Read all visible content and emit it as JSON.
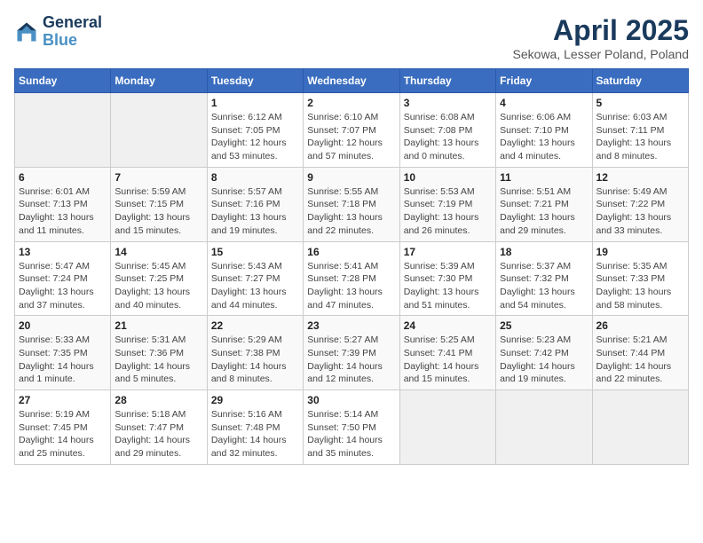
{
  "header": {
    "logo_line1": "General",
    "logo_line2": "Blue",
    "title": "April 2025",
    "subtitle": "Sekowa, Lesser Poland, Poland"
  },
  "weekdays": [
    "Sunday",
    "Monday",
    "Tuesday",
    "Wednesday",
    "Thursday",
    "Friday",
    "Saturday"
  ],
  "weeks": [
    [
      {
        "day": null
      },
      {
        "day": null
      },
      {
        "day": "1",
        "sunrise": "Sunrise: 6:12 AM",
        "sunset": "Sunset: 7:05 PM",
        "daylight": "Daylight: 12 hours and 53 minutes."
      },
      {
        "day": "2",
        "sunrise": "Sunrise: 6:10 AM",
        "sunset": "Sunset: 7:07 PM",
        "daylight": "Daylight: 12 hours and 57 minutes."
      },
      {
        "day": "3",
        "sunrise": "Sunrise: 6:08 AM",
        "sunset": "Sunset: 7:08 PM",
        "daylight": "Daylight: 13 hours and 0 minutes."
      },
      {
        "day": "4",
        "sunrise": "Sunrise: 6:06 AM",
        "sunset": "Sunset: 7:10 PM",
        "daylight": "Daylight: 13 hours and 4 minutes."
      },
      {
        "day": "5",
        "sunrise": "Sunrise: 6:03 AM",
        "sunset": "Sunset: 7:11 PM",
        "daylight": "Daylight: 13 hours and 8 minutes."
      }
    ],
    [
      {
        "day": "6",
        "sunrise": "Sunrise: 6:01 AM",
        "sunset": "Sunset: 7:13 PM",
        "daylight": "Daylight: 13 hours and 11 minutes."
      },
      {
        "day": "7",
        "sunrise": "Sunrise: 5:59 AM",
        "sunset": "Sunset: 7:15 PM",
        "daylight": "Daylight: 13 hours and 15 minutes."
      },
      {
        "day": "8",
        "sunrise": "Sunrise: 5:57 AM",
        "sunset": "Sunset: 7:16 PM",
        "daylight": "Daylight: 13 hours and 19 minutes."
      },
      {
        "day": "9",
        "sunrise": "Sunrise: 5:55 AM",
        "sunset": "Sunset: 7:18 PM",
        "daylight": "Daylight: 13 hours and 22 minutes."
      },
      {
        "day": "10",
        "sunrise": "Sunrise: 5:53 AM",
        "sunset": "Sunset: 7:19 PM",
        "daylight": "Daylight: 13 hours and 26 minutes."
      },
      {
        "day": "11",
        "sunrise": "Sunrise: 5:51 AM",
        "sunset": "Sunset: 7:21 PM",
        "daylight": "Daylight: 13 hours and 29 minutes."
      },
      {
        "day": "12",
        "sunrise": "Sunrise: 5:49 AM",
        "sunset": "Sunset: 7:22 PM",
        "daylight": "Daylight: 13 hours and 33 minutes."
      }
    ],
    [
      {
        "day": "13",
        "sunrise": "Sunrise: 5:47 AM",
        "sunset": "Sunset: 7:24 PM",
        "daylight": "Daylight: 13 hours and 37 minutes."
      },
      {
        "day": "14",
        "sunrise": "Sunrise: 5:45 AM",
        "sunset": "Sunset: 7:25 PM",
        "daylight": "Daylight: 13 hours and 40 minutes."
      },
      {
        "day": "15",
        "sunrise": "Sunrise: 5:43 AM",
        "sunset": "Sunset: 7:27 PM",
        "daylight": "Daylight: 13 hours and 44 minutes."
      },
      {
        "day": "16",
        "sunrise": "Sunrise: 5:41 AM",
        "sunset": "Sunset: 7:28 PM",
        "daylight": "Daylight: 13 hours and 47 minutes."
      },
      {
        "day": "17",
        "sunrise": "Sunrise: 5:39 AM",
        "sunset": "Sunset: 7:30 PM",
        "daylight": "Daylight: 13 hours and 51 minutes."
      },
      {
        "day": "18",
        "sunrise": "Sunrise: 5:37 AM",
        "sunset": "Sunset: 7:32 PM",
        "daylight": "Daylight: 13 hours and 54 minutes."
      },
      {
        "day": "19",
        "sunrise": "Sunrise: 5:35 AM",
        "sunset": "Sunset: 7:33 PM",
        "daylight": "Daylight: 13 hours and 58 minutes."
      }
    ],
    [
      {
        "day": "20",
        "sunrise": "Sunrise: 5:33 AM",
        "sunset": "Sunset: 7:35 PM",
        "daylight": "Daylight: 14 hours and 1 minute."
      },
      {
        "day": "21",
        "sunrise": "Sunrise: 5:31 AM",
        "sunset": "Sunset: 7:36 PM",
        "daylight": "Daylight: 14 hours and 5 minutes."
      },
      {
        "day": "22",
        "sunrise": "Sunrise: 5:29 AM",
        "sunset": "Sunset: 7:38 PM",
        "daylight": "Daylight: 14 hours and 8 minutes."
      },
      {
        "day": "23",
        "sunrise": "Sunrise: 5:27 AM",
        "sunset": "Sunset: 7:39 PM",
        "daylight": "Daylight: 14 hours and 12 minutes."
      },
      {
        "day": "24",
        "sunrise": "Sunrise: 5:25 AM",
        "sunset": "Sunset: 7:41 PM",
        "daylight": "Daylight: 14 hours and 15 minutes."
      },
      {
        "day": "25",
        "sunrise": "Sunrise: 5:23 AM",
        "sunset": "Sunset: 7:42 PM",
        "daylight": "Daylight: 14 hours and 19 minutes."
      },
      {
        "day": "26",
        "sunrise": "Sunrise: 5:21 AM",
        "sunset": "Sunset: 7:44 PM",
        "daylight": "Daylight: 14 hours and 22 minutes."
      }
    ],
    [
      {
        "day": "27",
        "sunrise": "Sunrise: 5:19 AM",
        "sunset": "Sunset: 7:45 PM",
        "daylight": "Daylight: 14 hours and 25 minutes."
      },
      {
        "day": "28",
        "sunrise": "Sunrise: 5:18 AM",
        "sunset": "Sunset: 7:47 PM",
        "daylight": "Daylight: 14 hours and 29 minutes."
      },
      {
        "day": "29",
        "sunrise": "Sunrise: 5:16 AM",
        "sunset": "Sunset: 7:48 PM",
        "daylight": "Daylight: 14 hours and 32 minutes."
      },
      {
        "day": "30",
        "sunrise": "Sunrise: 5:14 AM",
        "sunset": "Sunset: 7:50 PM",
        "daylight": "Daylight: 14 hours and 35 minutes."
      },
      {
        "day": null
      },
      {
        "day": null
      },
      {
        "day": null
      }
    ]
  ]
}
